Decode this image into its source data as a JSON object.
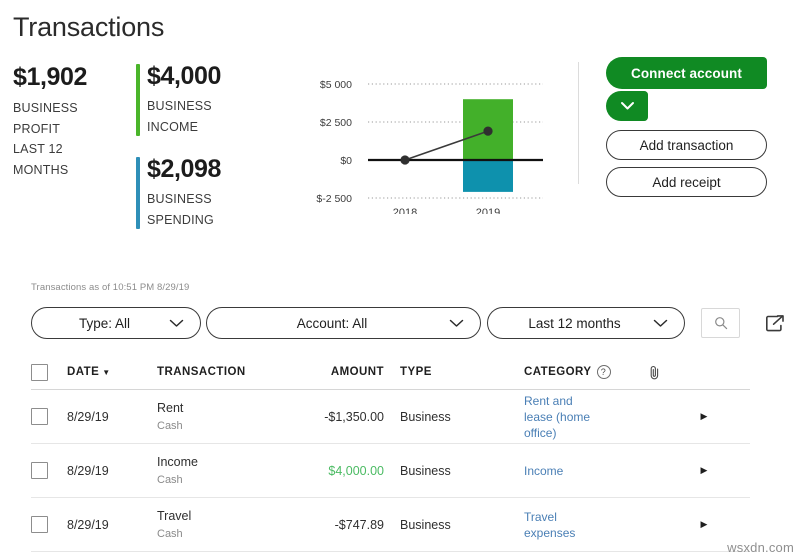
{
  "header": {
    "title": "Transactions"
  },
  "summary": {
    "profit": {
      "amount": "$1,902",
      "line1": "BUSINESS",
      "line2": "PROFIT",
      "line3": "LAST 12",
      "line4": "MONTHS"
    },
    "items": [
      {
        "amount": "$4,000",
        "line1": "BUSINESS",
        "line2": "INCOME",
        "color": "#4ab52a"
      },
      {
        "amount": "$2,098",
        "line1": "BUSINESS",
        "line2": "SPENDING",
        "color": "#2e8fb8"
      }
    ]
  },
  "chart_data": {
    "type": "bar",
    "title": "",
    "xlabel": "",
    "ylabel": "",
    "categories": [
      "2018",
      "2019"
    ],
    "ytick_labels": [
      "$5 000",
      "$2 500",
      "$0",
      "$-2 500"
    ],
    "ytick_values": [
      5000,
      2500,
      0,
      -2500
    ],
    "ylim": [
      -2500,
      5000
    ],
    "grid": true,
    "legend": "none",
    "series": [
      {
        "name": "Business income",
        "type": "bar",
        "color": "#43b02a",
        "categories": [
          "2018",
          "2019"
        ],
        "values": [
          0,
          4000
        ]
      },
      {
        "name": "Business spending",
        "type": "bar",
        "color": "#0e91ad",
        "categories": [
          "2018",
          "2019"
        ],
        "values": [
          0,
          -2098
        ]
      },
      {
        "name": "Business profit",
        "type": "line",
        "color": "#3a3a3a",
        "categories": [
          "2018",
          "2019"
        ],
        "values": [
          0,
          1902
        ]
      }
    ]
  },
  "actions": {
    "connect_account": "Connect account",
    "connect_caret": "chevron-down-icon",
    "add_transaction": "Add transaction",
    "add_receipt": "Add receipt",
    "green": "#108a23"
  },
  "filters": {
    "as_of": "Transactions as of 10:51 PM 8/29/19",
    "type": "Type: All",
    "account": "Account: All",
    "range": "Last 12 months",
    "search_icon": "search-icon",
    "export_icon": "export-icon"
  },
  "table": {
    "columns": {
      "date": "DATE",
      "sort_caret": "▼",
      "transaction": "TRANSACTION",
      "amount": "AMOUNT",
      "type": "TYPE",
      "category": "CATEGORY",
      "help": "?",
      "attachment": "paperclip-icon"
    },
    "rows": [
      {
        "date": "8/29/19",
        "name": "Rent",
        "source": "Cash",
        "amount": "-$1,350.00",
        "amount_sign": "negative",
        "type": "Business",
        "category": "Rent and lease (home office)",
        "arrow": "▶"
      },
      {
        "date": "8/29/19",
        "name": "Income",
        "source": "Cash",
        "amount": "$4,000.00",
        "amount_sign": "positive",
        "type": "Business",
        "category": "Income",
        "arrow": "▶"
      },
      {
        "date": "8/29/19",
        "name": "Travel",
        "source": "Cash",
        "amount": "-$747.89",
        "amount_sign": "negative",
        "type": "Business",
        "category": "Travel expenses",
        "arrow": "▶"
      }
    ]
  },
  "watermark": "wsxdn.com"
}
